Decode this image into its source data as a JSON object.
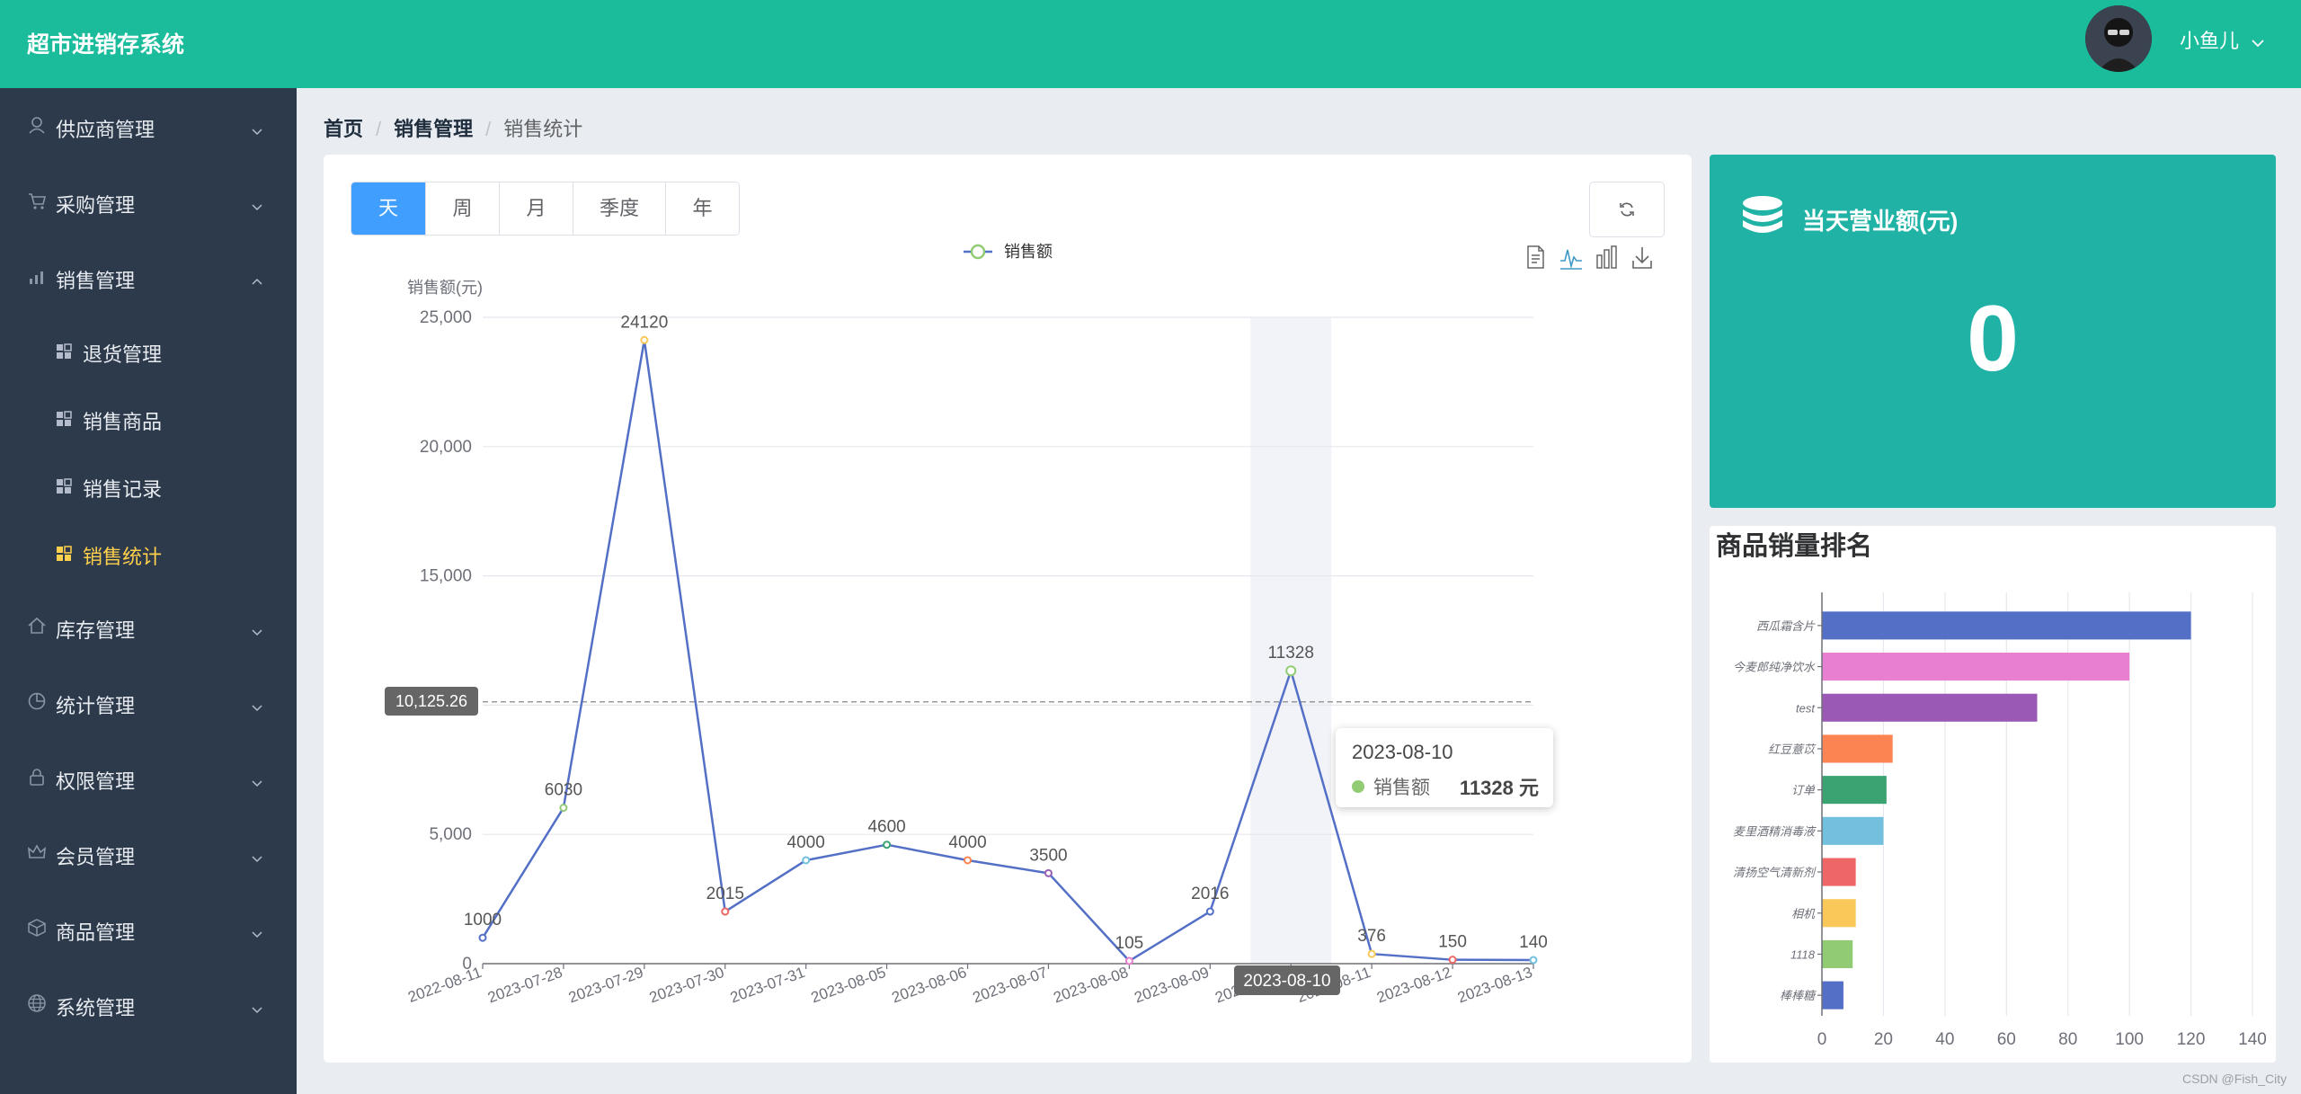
{
  "app": {
    "title": "超市进销存系统",
    "user_name": "小鱼儿"
  },
  "sidebar": {
    "items": [
      {
        "label": "供应商管理"
      },
      {
        "label": "采购管理"
      },
      {
        "label": "销售管理",
        "children": [
          {
            "label": "退货管理"
          },
          {
            "label": "销售商品"
          },
          {
            "label": "销售记录"
          },
          {
            "label": "销售统计",
            "active": true
          }
        ]
      },
      {
        "label": "库存管理"
      },
      {
        "label": "统计管理"
      },
      {
        "label": "权限管理"
      },
      {
        "label": "会员管理"
      },
      {
        "label": "商品管理"
      },
      {
        "label": "系统管理"
      }
    ]
  },
  "breadcrumb": {
    "home": "首页",
    "parent": "销售管理",
    "current": "销售统计"
  },
  "period_tabs": [
    "天",
    "周",
    "月",
    "季度",
    "年"
  ],
  "period_selected": "天",
  "stats_card": {
    "title": "当天营业额(元)",
    "value": "0"
  },
  "ranking_card": {
    "title": "商品销量排名"
  },
  "tooltip": {
    "date": "2023-08-10",
    "series": "销售额",
    "value": "11328 元"
  },
  "axis_pointer_label": "2023-08-10",
  "watermark": "CSDN @Fish_City",
  "colors": {
    "header": "#1abc9c",
    "sidebar": "#2d3a4b",
    "active_menu": "#ffd04b",
    "accent": "#409eff",
    "stats_card": "#20b2a5",
    "line": "#5470c6",
    "point": "#91cc75"
  },
  "chart_data": [
    {
      "type": "line",
      "legend": [
        "销售额"
      ],
      "ylabel": "销售额(元)",
      "ylim": [
        0,
        25000
      ],
      "yticks": [
        "0",
        "5,000",
        "10,000",
        "15,000",
        "20,000",
        "25,000"
      ],
      "categories": [
        "2022-08-11",
        "2023-07-28",
        "2023-07-29",
        "2023-07-30",
        "2023-07-31",
        "2023-08-05",
        "2023-08-06",
        "2023-08-07",
        "2023-08-08",
        "2023-08-09",
        "2023-08-10",
        "2023-08-11",
        "2023-08-12",
        "2023-08-13"
      ],
      "series": [
        {
          "name": "销售额",
          "values": [
            1000,
            6030,
            24120,
            2015,
            4000,
            4600,
            4000,
            3500,
            105,
            2016,
            11328,
            376,
            150,
            140
          ]
        }
      ],
      "average_line": {
        "value": 10125.26,
        "label": "10,125.26"
      },
      "highlighted_category": "2023-08-10",
      "legend_position": "top-center",
      "toolbox": [
        "data-view",
        "line",
        "bar",
        "save-image"
      ]
    },
    {
      "type": "bar",
      "orientation": "horizontal",
      "title": "商品销量排名",
      "categories": [
        "西瓜霜含片",
        "今麦郎纯净饮水",
        "test",
        "红豆薏苡",
        "订单",
        "麦里酒精消毒液",
        "清扬空气清新剂",
        "相机",
        "1118",
        "棒棒糖"
      ],
      "values": [
        120,
        100,
        70,
        23,
        21,
        20,
        11,
        11,
        10,
        7
      ],
      "xlim": [
        0,
        140
      ],
      "xticks": [
        "0",
        "20",
        "40",
        "60",
        "80",
        "100",
        "120",
        "140"
      ],
      "colors": [
        "#5470c6",
        "#e97fd0",
        "#9b59b6",
        "#fc8452",
        "#3ba272",
        "#73c0de",
        "#ee6666",
        "#fac858",
        "#91cc75",
        "#5470c6"
      ]
    }
  ]
}
